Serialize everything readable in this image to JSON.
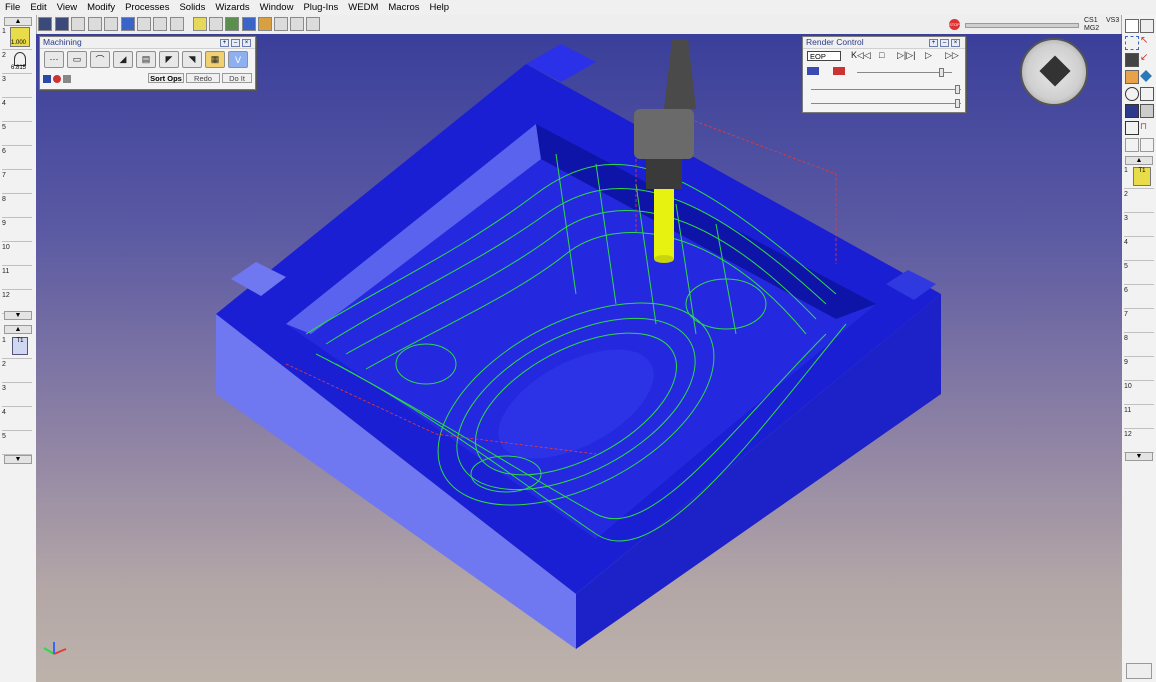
{
  "menu": [
    "File",
    "Edit",
    "View",
    "Modify",
    "Processes",
    "Solids",
    "Wizards",
    "Window",
    "Plug-Ins",
    "WEDM",
    "Macros",
    "Help"
  ],
  "status": {
    "cs": "CS1",
    "vs": "VS3",
    "mg": "MG2",
    "stop_label": "STOP"
  },
  "left_panel": {
    "slot1_value": "1.000",
    "slot2_value": "6.815",
    "numbers_top": [
      "1",
      "2",
      "3",
      "4",
      "5",
      "6",
      "7",
      "8",
      "9",
      "10",
      "11",
      "12"
    ],
    "numbers_bottom": [
      "1",
      "2",
      "3",
      "4",
      "5"
    ],
    "tool_label": "T1"
  },
  "right_panel": {
    "tool_label": "T1",
    "numbers": [
      "1",
      "2",
      "3",
      "4",
      "5",
      "6",
      "7",
      "8",
      "9",
      "10",
      "11",
      "12"
    ]
  },
  "machining": {
    "title": "Machining",
    "sort_label": "Sort Ops",
    "redo_label": "Redo",
    "doit_label": "Do It"
  },
  "render_control": {
    "title": "Render Control",
    "field_value": "EOP",
    "controls": [
      "K◁◁",
      "□",
      "▷|▷|",
      "▷",
      "▷▷"
    ]
  },
  "colors": {
    "model": "#1f22d8",
    "model_face": "#6f78f0",
    "toolpath": "#2fd84a",
    "toolpath_red": "#e83a3a",
    "tool_tip": "#e7f210"
  }
}
